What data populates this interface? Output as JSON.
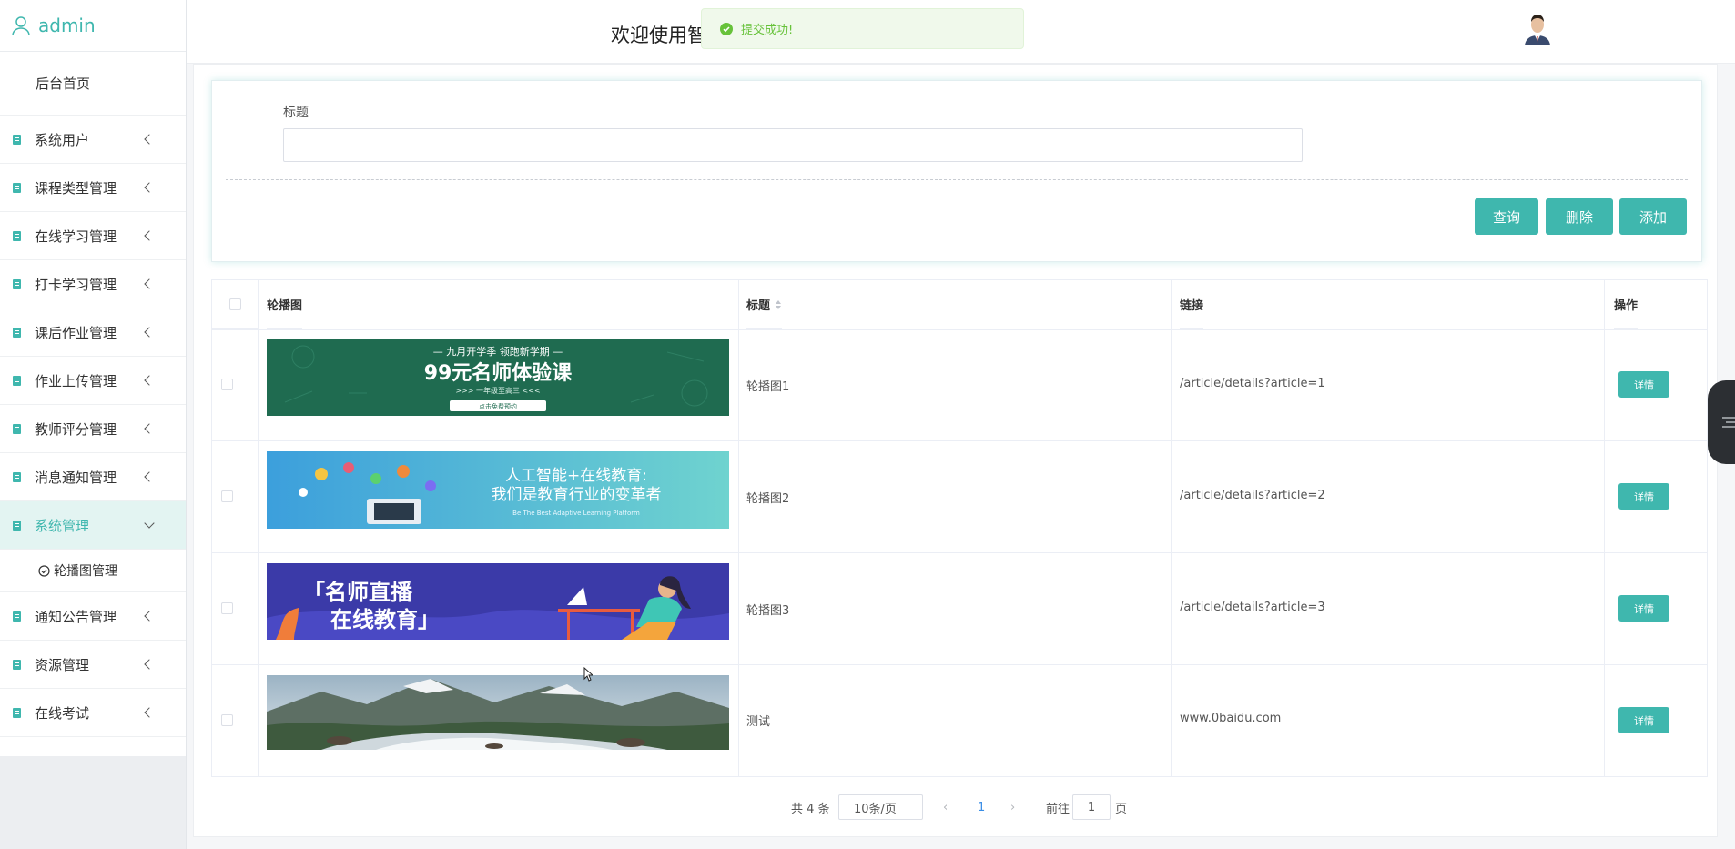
{
  "sidebar": {
    "username": "admin",
    "home_label": "后台首页",
    "items": [
      {
        "label": "系统用户"
      },
      {
        "label": "课程类型管理"
      },
      {
        "label": "在线学习管理"
      },
      {
        "label": "打卡学习管理"
      },
      {
        "label": "课后作业管理"
      },
      {
        "label": "作业上传管理"
      },
      {
        "label": "教师评分管理"
      },
      {
        "label": "消息通知管理"
      },
      {
        "label": "系统管理"
      },
      {
        "label": "通知公告管理"
      },
      {
        "label": "资源管理"
      },
      {
        "label": "在线考试"
      }
    ],
    "active_submenu": "轮播图管理"
  },
  "header": {
    "welcome_text": "欢迎使用智",
    "toast": "提交成功!"
  },
  "search": {
    "title_label": "标题",
    "query_button": "查询",
    "delete_button": "删除",
    "add_button": "添加"
  },
  "table": {
    "headers": {
      "image": "轮播图",
      "title": "标题",
      "link": "链接",
      "actions": "操作"
    },
    "rows": [
      {
        "title": "轮播图1",
        "link": "/article/details?article=1",
        "action": "详情",
        "banner": {
          "line1": "— 九月开学季  领跑新学期 —",
          "line2": "99元名师体验课",
          "line3": ">>>  一年级至高三  <<<",
          "btn": "点击免费预约"
        }
      },
      {
        "title": "轮播图2",
        "link": "/article/details?article=2",
        "action": "详情",
        "banner": {
          "line1": "人工智能+在线教育:",
          "line2": "我们是教育行业的变革者",
          "line3": "Be The Best Adaptive Learning Platform"
        }
      },
      {
        "title": "轮播图3",
        "link": "/article/details?article=3",
        "action": "详情",
        "banner": {
          "line1": "「名师直播",
          "line2": "在线教育」"
        }
      },
      {
        "title": "测试",
        "link": "www.0baidu.com",
        "action": "详情"
      }
    ]
  },
  "pagination": {
    "total": "共 4 条",
    "page_size": "10条/页",
    "current_page": "1",
    "goto_prefix": "前往",
    "goto_value": "1",
    "goto_suffix": "页"
  },
  "colors": {
    "accent": "#3fb7ae",
    "toast_bg": "#f0f9eb",
    "toast_text": "#67c23a"
  }
}
